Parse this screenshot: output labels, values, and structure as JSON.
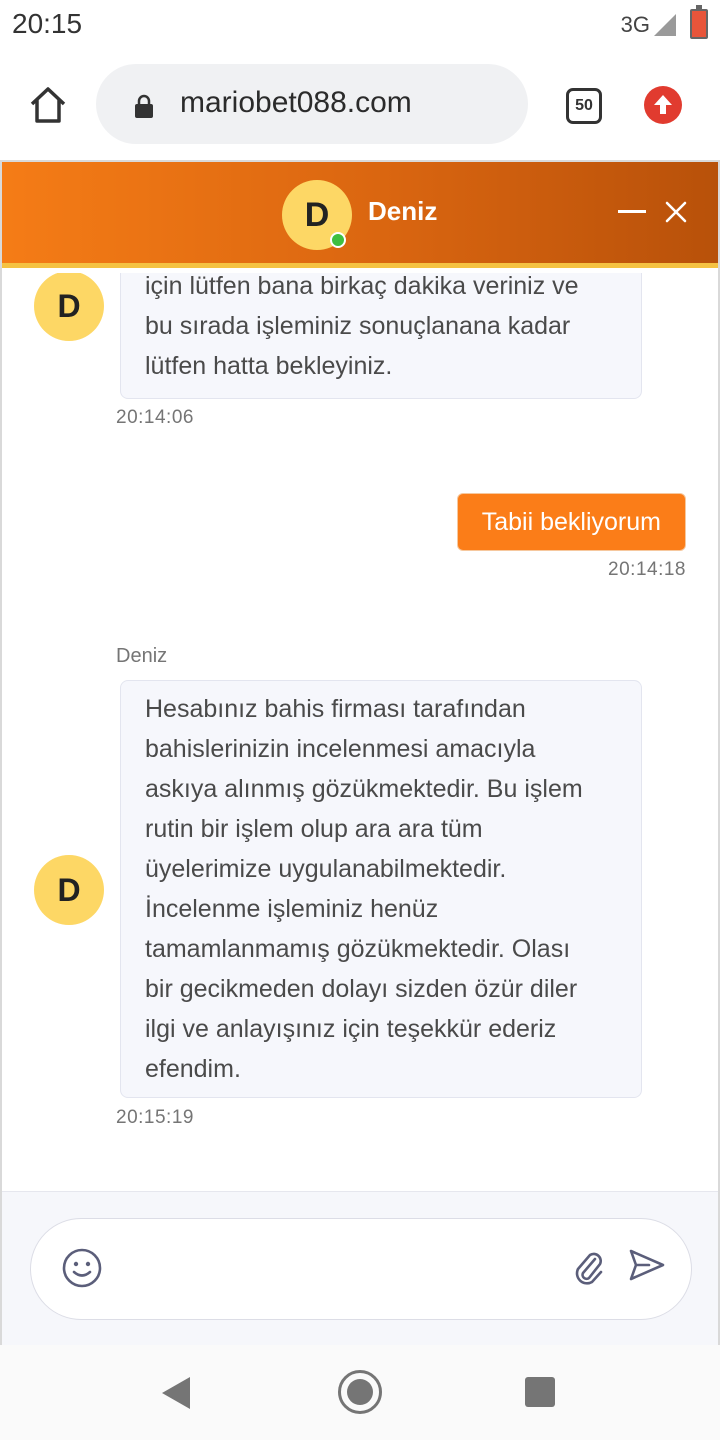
{
  "status_bar": {
    "time": "20:15",
    "network": "3G"
  },
  "browser": {
    "url": "mariobet088.com",
    "tab_count": "50"
  },
  "chat": {
    "agent_name": "Deniz",
    "agent_initial": "D",
    "messages": [
      {
        "type": "incoming",
        "lines": [
          "için lütfen bana birkaç dakika veriniz ve",
          "bu sırada işleminiz sonuçlanana kadar",
          "lütfen hatta bekleyiniz."
        ],
        "time": "20:14:06"
      },
      {
        "type": "outgoing",
        "text": "Tabii bekliyorum",
        "time": "20:14:18"
      },
      {
        "type": "incoming",
        "sender": "Deniz",
        "lines": [
          "Hesabınız bahis firması tarafından",
          "bahislerinizin incelenmesi amacıyla",
          "askıya alınmış gözükmektedir. Bu işlem",
          "rutin bir işlem olup ara ara tüm",
          "üyelerimize uygulanabilmektedir.",
          "İncelenme işleminiz henüz",
          "tamamlanmamış gözükmektedir. Olası",
          "bir gecikmeden dolayı sizden özür diler",
          "ilgi ve anlayışınız için teşekkür ederiz",
          "efendim."
        ],
        "time": "20:15:19"
      }
    ]
  },
  "composer": {
    "placeholder": ""
  },
  "colors": {
    "accent": "#fb7d18",
    "header_gradient_start": "#f57c16",
    "header_gradient_end": "#b8510a",
    "avatar": "#fdd765",
    "online": "#3fbf3f"
  }
}
